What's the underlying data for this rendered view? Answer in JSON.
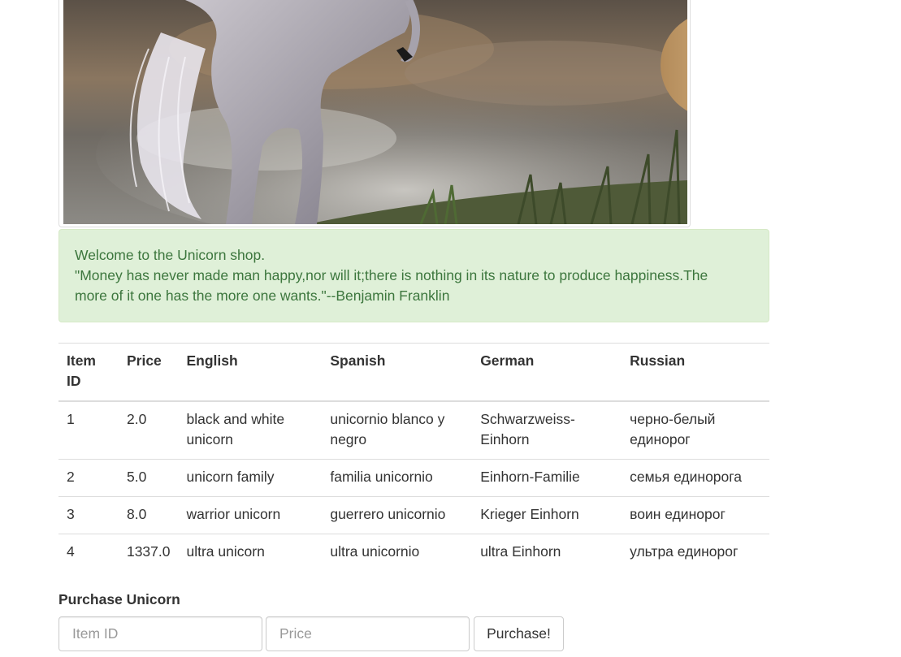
{
  "alert": {
    "welcome": "Welcome to the Unicorn shop.",
    "quote": "\"Money has never made man happy,nor will it;there is nothing in its nature to produce happiness.The more of it one has the more one wants.\"--Benjamin Franklin"
  },
  "table": {
    "headers": [
      "Item ID",
      "Price",
      "English",
      "Spanish",
      "German",
      "Russian"
    ],
    "rows": [
      [
        "1",
        "2.0",
        "black and white unicorn",
        "unicornio blanco y negro",
        "Schwarzweiss-Einhorn",
        "черно-белый единорог"
      ],
      [
        "2",
        "5.0",
        "unicorn family",
        "familia unicornio",
        "Einhorn-Familie",
        "семья единорога"
      ],
      [
        "3",
        "8.0",
        "warrior unicorn",
        "guerrero unicornio",
        "Krieger Einhorn",
        "воин единорог"
      ],
      [
        "4",
        "1337.0",
        "ultra unicorn",
        "ultra unicornio",
        "ultra Einhorn",
        "ультра единорог"
      ]
    ]
  },
  "purchase": {
    "label": "Purchase Unicorn",
    "item_id_placeholder": "Item ID",
    "price_placeholder": "Price",
    "button_label": "Purchase!"
  },
  "colors": {
    "alert_bg": "#dff0d8",
    "alert_text": "#3c763d",
    "border": "#dddddd"
  }
}
